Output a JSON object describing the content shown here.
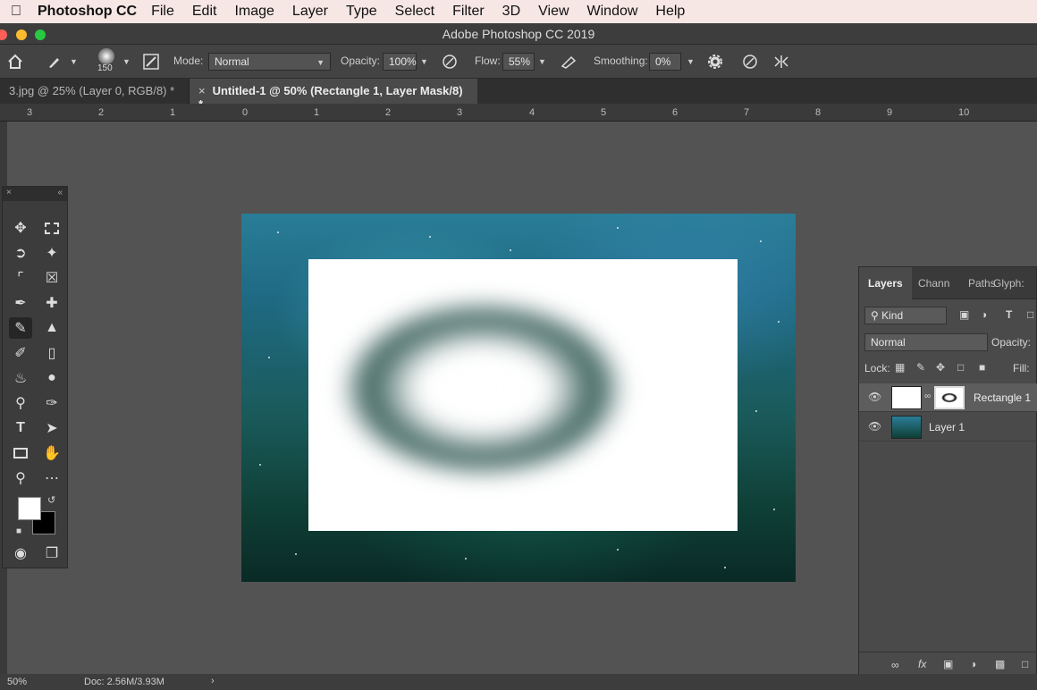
{
  "menubar": {
    "app_name": "Photoshop CC",
    "items": [
      "File",
      "Edit",
      "Image",
      "Layer",
      "Type",
      "Select",
      "Filter",
      "3D",
      "View",
      "Window",
      "Help"
    ]
  },
  "window": {
    "title": "Adobe Photoshop CC 2019"
  },
  "options": {
    "brush_size": "150",
    "mode_label": "Mode:",
    "mode_value": "Normal",
    "opacity_label": "Opacity:",
    "opacity_value": "100%",
    "flow_label": "Flow:",
    "flow_value": "55%",
    "smoothing_label": "Smoothing:",
    "smoothing_value": "0%"
  },
  "tabs": [
    {
      "label": "3.jpg @ 25% (Layer 0, RGB/8) *"
    },
    {
      "label": "Untitled-1 @ 50% (Rectangle 1, Layer Mask/8) *"
    }
  ],
  "ruler": {
    "labels": [
      "3",
      "2",
      "1",
      "0",
      "1",
      "2",
      "3",
      "4",
      "5",
      "6",
      "7",
      "8",
      "9",
      "10"
    ]
  },
  "tools_panel": {
    "tools": [
      "move-icon",
      "marquee-icon",
      "lasso-icon",
      "magic-wand-icon",
      "crop-icon",
      "frame-icon",
      "eyedropper-icon",
      "healing-brush-icon",
      "brush-icon",
      "stamp-icon",
      "history-brush-icon",
      "eraser-icon",
      "paint-bucket-icon",
      "blur-icon",
      "dodge-icon",
      "pen-icon",
      "type-icon",
      "path-select-icon",
      "rectangle-icon",
      "hand-icon",
      "zoom-icon",
      "more-icon"
    ],
    "foreground_color": "#ffffff",
    "background_color": "#000000"
  },
  "layers_panel": {
    "tabs": [
      "Layers",
      "Chann",
      "Paths",
      "Glyph:"
    ],
    "kind_label": "Kind",
    "blend_mode": "Normal",
    "opacity_label": "Opacity:",
    "lock_label": "Lock:",
    "fill_label": "Fill:",
    "layers": [
      {
        "name": "Rectangle 1",
        "selected": true
      },
      {
        "name": "Layer 1",
        "selected": false
      }
    ]
  },
  "status": {
    "zoom": "50%",
    "doc_info": "Doc: 2.56M/3.93M"
  }
}
